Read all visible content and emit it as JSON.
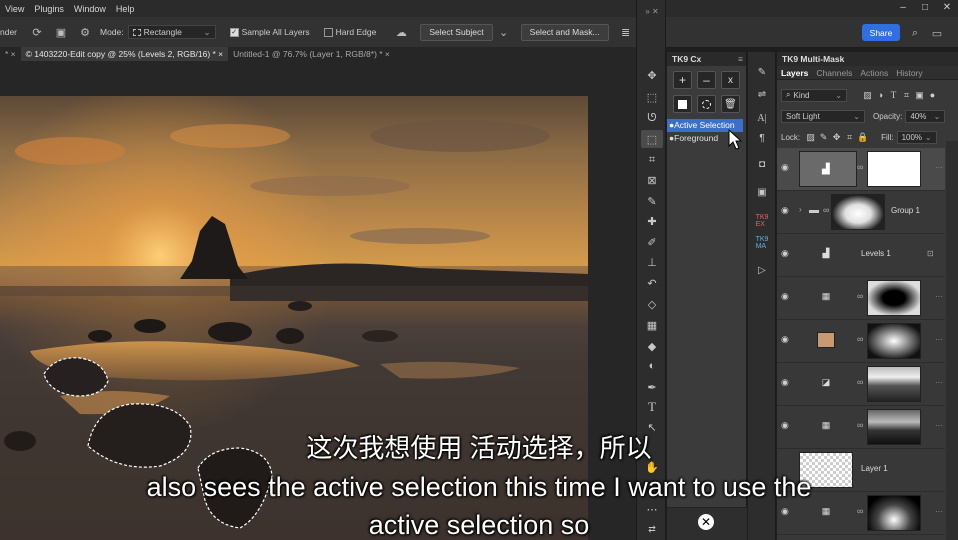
{
  "menu": [
    "View",
    "Plugins",
    "Window",
    "Help"
  ],
  "window_controls": [
    "–",
    "□",
    "✕"
  ],
  "options_bar": {
    "cut_tool_label": "nder",
    "mode_label": "Mode:",
    "mode_value": "Rectangle",
    "sample_all_layers": "Sample All Layers",
    "hard_edge": "Hard Edge",
    "select_subject": "Select Subject",
    "select_and_mask": "Select and Mask...",
    "share": "Share"
  },
  "tabs": [
    {
      "label": "* ×"
    },
    {
      "label": "© 1403220-Edit copy @ 25% (Levels 2, RGB/16) * ×"
    },
    {
      "label": "Untitled-1 @ 76.7% (Layer 1, RGB/8*) * ×"
    }
  ],
  "cx_panel": {
    "title": "TK9 Cx",
    "add_label": "+",
    "subtract_label": "–",
    "intersect_label": "x",
    "items": [
      "●Active Selection",
      "●Foreground"
    ]
  },
  "layers_panel": {
    "title": "TK9 Multi-Mask",
    "tabs": [
      "Layers",
      "Channels",
      "Actions",
      "History"
    ],
    "kind_filter": "Kind",
    "blend_mode": "Soft Light",
    "opacity_label": "Opacity:",
    "opacity_value": "40%",
    "lock_label": "Lock:",
    "fill_label": "Fill:",
    "fill_value": "100%",
    "layers": [
      {
        "name": ""
      },
      {
        "name": "Group 1"
      },
      {
        "name": "Levels 1"
      },
      {
        "name": ""
      },
      {
        "name": ""
      },
      {
        "name": ""
      },
      {
        "name": ""
      },
      {
        "name": "Layer 1"
      },
      {
        "name": ""
      }
    ]
  },
  "subtitles": {
    "chinese": "这次我想使用 活动选择，所以",
    "english_line1": "also sees the active selection this time I want to use the",
    "english_line2": "active selection so"
  }
}
